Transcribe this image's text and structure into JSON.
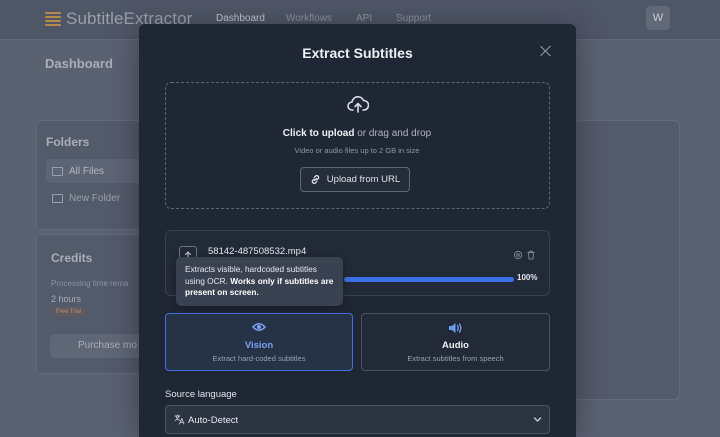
{
  "app": {
    "brand": "SubtitleExtractor",
    "nav": [
      "Dashboard",
      "Workflows",
      "API",
      "Support"
    ],
    "avatar_initial": "W"
  },
  "background": {
    "page_title": "Dashboard",
    "folders": {
      "title": "Folders",
      "items": [
        "All Files",
        "New Folder"
      ]
    },
    "credits": {
      "title": "Credits",
      "processing_label": "Processing time rema",
      "processing_value": "2 hours",
      "badge": "Free Trial",
      "purchase_label": "Purchase mo"
    }
  },
  "modal": {
    "title": "Extract Subtitles",
    "dropzone": {
      "click_text": "Click to upload",
      "rest_text": " or drag and drop",
      "hint": "Video or audio files up to 2 GB in size",
      "url_button": "Upload from URL"
    },
    "file": {
      "name": "58142-487508532.mp4",
      "progress": 1.0,
      "progress_label": "100%"
    },
    "tooltip": {
      "text": "Extracts visible, hardcoded subtitles using OCR.",
      "bold": "Works only if subtitles are present on screen."
    },
    "options": {
      "vision": {
        "title": "Vision",
        "desc": "Extract hard-coded subtitles"
      },
      "audio": {
        "title": "Audio",
        "desc": "Extract subtitles from speech"
      }
    },
    "source_language": {
      "label": "Source language",
      "value": "Auto-Detect"
    }
  },
  "colors": {
    "accent": "#3f72e0",
    "modal_bg": "#202734"
  },
  "icons": [
    "close-icon",
    "cloud-upload-icon",
    "link-icon",
    "upload-icon",
    "gear-icon",
    "trash-icon",
    "eye-icon",
    "speaker-icon",
    "translate-icon",
    "chevron-down-icon"
  ]
}
